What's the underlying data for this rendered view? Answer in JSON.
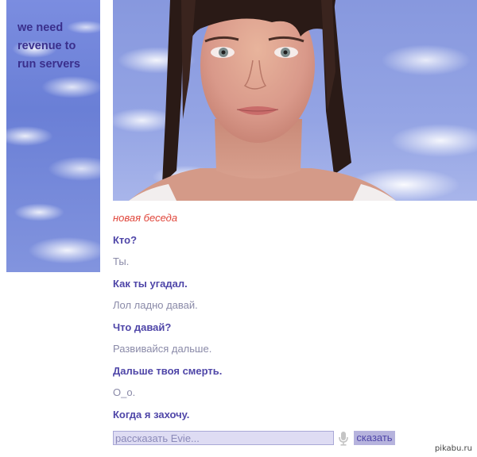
{
  "sidebar": {
    "notice_lines": [
      "we need",
      "revenue to",
      "run servers"
    ]
  },
  "avatar": {
    "name": "Evie"
  },
  "chat": {
    "new_chat_label": "новая беседа",
    "messages": [
      {
        "role": "user",
        "text": "Кто?"
      },
      {
        "role": "bot",
        "text": "Ты."
      },
      {
        "role": "user",
        "text": "Как ты угадал."
      },
      {
        "role": "bot",
        "text": "Лол ладно давай."
      },
      {
        "role": "user",
        "text": "Что давай?"
      },
      {
        "role": "bot",
        "text": "Развивайся дальше."
      },
      {
        "role": "user",
        "text": "Дальше твоя смерть."
      },
      {
        "role": "bot",
        "text": "О_о."
      },
      {
        "role": "user",
        "text": "Когда я захочу."
      }
    ]
  },
  "input": {
    "placeholder": "рассказать Evie...",
    "value": ""
  },
  "controls": {
    "mic_icon": "microphone-icon",
    "say_label": "сказать"
  },
  "watermark": "pikabu.ru",
  "colors": {
    "user_text": "#4f46a8",
    "bot_text": "#8a8aa8",
    "new_chat": "#e0453a",
    "sidebar_text": "#3a2f8c",
    "input_bg": "#dedcf3",
    "button_bg": "#b6b3dd"
  }
}
